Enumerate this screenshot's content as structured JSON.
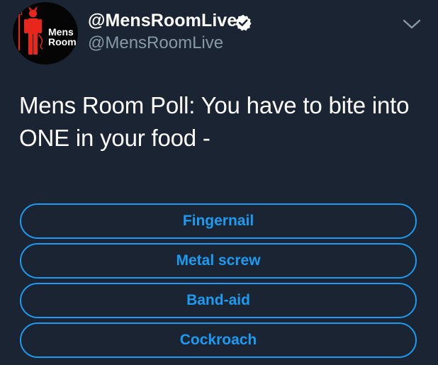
{
  "user": {
    "display_name": "@MensRoomLive",
    "handle": "@MensRoomLive",
    "verified": true,
    "avatar_text_line1": "Mens",
    "avatar_text_line2": "Room"
  },
  "tweet": {
    "text": "Mens Room Poll: You have to bite into ONE in your food -"
  },
  "poll": {
    "options": [
      "Fingernail",
      "Metal screw",
      "Band-aid",
      "Cockroach"
    ]
  },
  "colors": {
    "background": "#1b2432",
    "accent": "#1d9bf0",
    "secondary_text": "#8899a6",
    "avatar_figure": "#e8261c"
  },
  "icons": {
    "verified": "verified-badge-icon",
    "menu": "chevron-down-icon"
  }
}
